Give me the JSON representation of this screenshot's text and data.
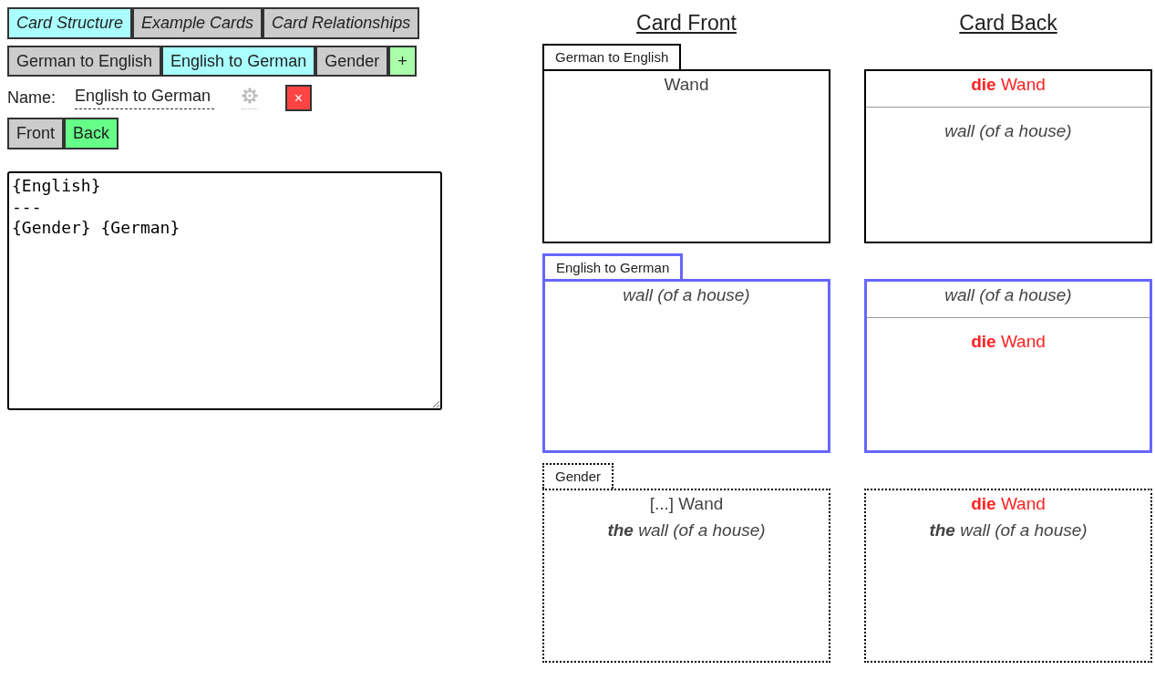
{
  "main_tabs": [
    {
      "label": "Card Structure",
      "selected": true
    },
    {
      "label": "Example Cards",
      "selected": false
    },
    {
      "label": "Card Relationships",
      "selected": false
    }
  ],
  "card_types": {
    "tabs": [
      {
        "label": "German to English",
        "selected": false
      },
      {
        "label": "English to German",
        "selected": true
      },
      {
        "label": "Gender",
        "selected": false
      }
    ],
    "add_button": "+"
  },
  "name_field": {
    "label": "Name:",
    "value": "English to German"
  },
  "delete_button": "×",
  "side_tabs": [
    {
      "label": "Front",
      "selected": false
    },
    {
      "label": "Back",
      "selected": true
    }
  ],
  "template_editor": {
    "value": "{English}\n---\n{Gender} {German}"
  },
  "preview": {
    "headings": [
      "Card Front",
      "Card Back"
    ],
    "rows": [
      {
        "label": "German to English",
        "selected": false,
        "kind": "normal",
        "front": [
          [
            {
              "text": "Wand",
              "kind": "german"
            }
          ]
        ],
        "back": [
          [
            {
              "text": "**die** Wand",
              "kind": "gendered"
            }
          ],
          [
            {
              "text": "wall (of a house)",
              "kind": "english"
            }
          ]
        ]
      },
      {
        "label": "English to German",
        "selected": true,
        "kind": "normal",
        "front": [
          [
            {
              "text": "wall (of a house)",
              "kind": "english"
            }
          ]
        ],
        "back": [
          [
            {
              "text": "wall (of a house)",
              "kind": "english"
            }
          ],
          [
            {
              "text": "**die** Wand",
              "kind": "gendered"
            }
          ]
        ]
      },
      {
        "label": "Gender",
        "selected": false,
        "kind": "cloze",
        "front": [
          [
            {
              "text": "[...] Wand",
              "kind": "german"
            },
            {
              "text": "**the** wall (of a house)",
              "kind": "english"
            }
          ]
        ],
        "back": [
          [
            {
              "text": "**die** Wand",
              "kind": "gendered"
            },
            {
              "text": "**the** wall (of a house)",
              "kind": "english"
            }
          ]
        ]
      }
    ]
  }
}
